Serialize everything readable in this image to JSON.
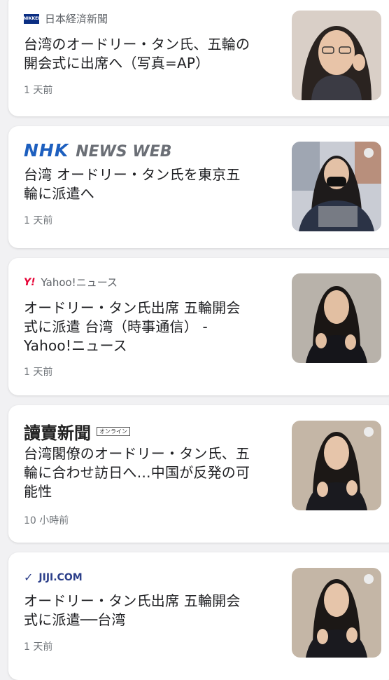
{
  "articles": [
    {
      "source": "日本経済新聞",
      "source_logo": "NIKKEI",
      "title_line1": "台湾のオードリー・タン氏、五輪の",
      "title_line2": "開会式に出席へ（写真=AP）",
      "title_line3": "",
      "time": "1 天前"
    },
    {
      "source_nhk": "NHK",
      "source_newsweb": "NEWS WEB",
      "title_line1": "台湾 オードリー・タン氏を東京五",
      "title_line2": "輪に派遣へ",
      "title_line3": "",
      "time": "1 天前"
    },
    {
      "source_logo": "Y!",
      "source": "Yahoo!ニュース",
      "title_line1": "オードリー・タン氏出席 五輪開会",
      "title_line2": "式に派遣 台湾（時事通信） -",
      "title_line3": "Yahoo!ニュース",
      "time": "1 天前"
    },
    {
      "source": "讀賣新聞",
      "source_tag": "オンライン",
      "title_line1": "台湾閣僚のオードリー・タン氏、五",
      "title_line2": "輪に合わせ訪日へ…中国が反発の可",
      "title_line3": "能性",
      "time": "10 小時前"
    },
    {
      "source": "JIJI.COM",
      "title_line1": "オードリー・タン氏出席 五輪開会",
      "title_line2": "式に派遣──台湾",
      "title_line3": "",
      "time": "1 天前"
    }
  ]
}
